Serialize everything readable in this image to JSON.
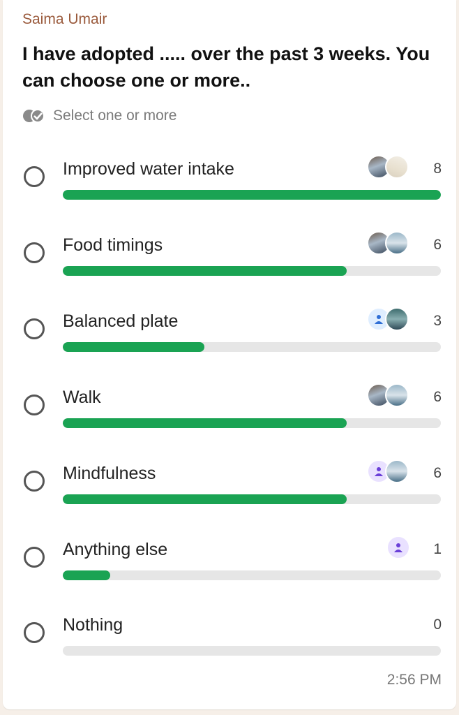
{
  "sender": "Saima Umair",
  "question": "I have adopted ..... over the past 3 weeks. You can choose one or more..",
  "hint": "Select one or more",
  "time": "2:56 PM",
  "colors": {
    "accent": "#1aa353",
    "sender": "#9a5a3c",
    "track": "#e6e6e6"
  },
  "options": [
    {
      "label": "Improved water intake",
      "count": "8",
      "fraction": 1.0,
      "avatars": [
        "photo-avatar",
        "photo-avatar"
      ]
    },
    {
      "label": "Food timings",
      "count": "6",
      "fraction": 0.75,
      "avatars": [
        "photo-avatar",
        "photo-avatar"
      ]
    },
    {
      "label": "Balanced plate",
      "count": "3",
      "fraction": 0.375,
      "avatars": [
        "default-user-icon-blue",
        "photo-avatar"
      ]
    },
    {
      "label": "Walk",
      "count": "6",
      "fraction": 0.75,
      "avatars": [
        "photo-avatar",
        "photo-avatar"
      ]
    },
    {
      "label": "Mindfulness",
      "count": "6",
      "fraction": 0.75,
      "avatars": [
        "default-user-icon-purple",
        "photo-avatar"
      ]
    },
    {
      "label": "Anything else",
      "count": "1",
      "fraction": 0.125,
      "avatars": [
        "default-user-icon-purple"
      ]
    },
    {
      "label": "Nothing",
      "count": "0",
      "fraction": 0.0,
      "avatars": []
    }
  ]
}
